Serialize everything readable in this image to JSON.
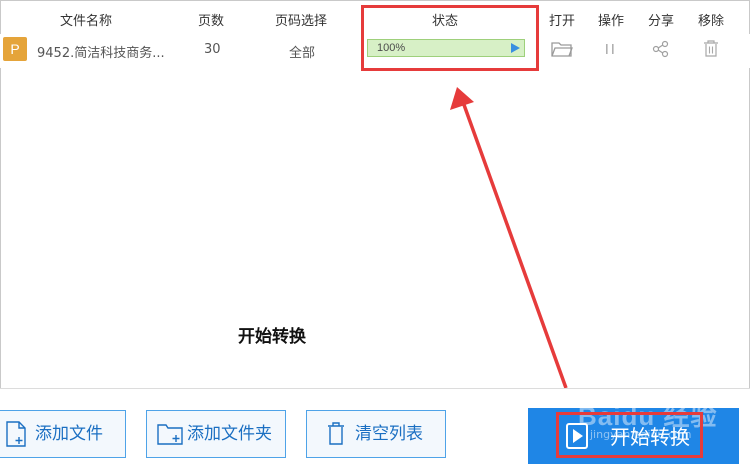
{
  "header": {
    "col_filename": "文件名称",
    "col_pages": "页数",
    "col_page_select": "页码选择",
    "col_status": "状态",
    "col_open": "打开",
    "col_action": "操作",
    "col_share": "分享",
    "col_remove": "移除"
  },
  "rows": [
    {
      "icon_letter": "P",
      "filename": "9452.简洁科技商务...",
      "pages": "30",
      "page_select": "全部",
      "progress_text": "100%",
      "progress": 1.0
    }
  ],
  "caption": "开始转换",
  "footer": {
    "add_file": "添加文件",
    "add_folder": "添加文件夹",
    "clear_list": "清空列表",
    "start": "开始转换"
  },
  "watermark": "Baidu 经验",
  "watermark_sub": "jingyan.baidu.com",
  "colors": {
    "accent": "#1f86e6",
    "highlight": "#e63b3b",
    "progress_bg": "#e9f7e0",
    "file_icon": "#e5a43a"
  }
}
